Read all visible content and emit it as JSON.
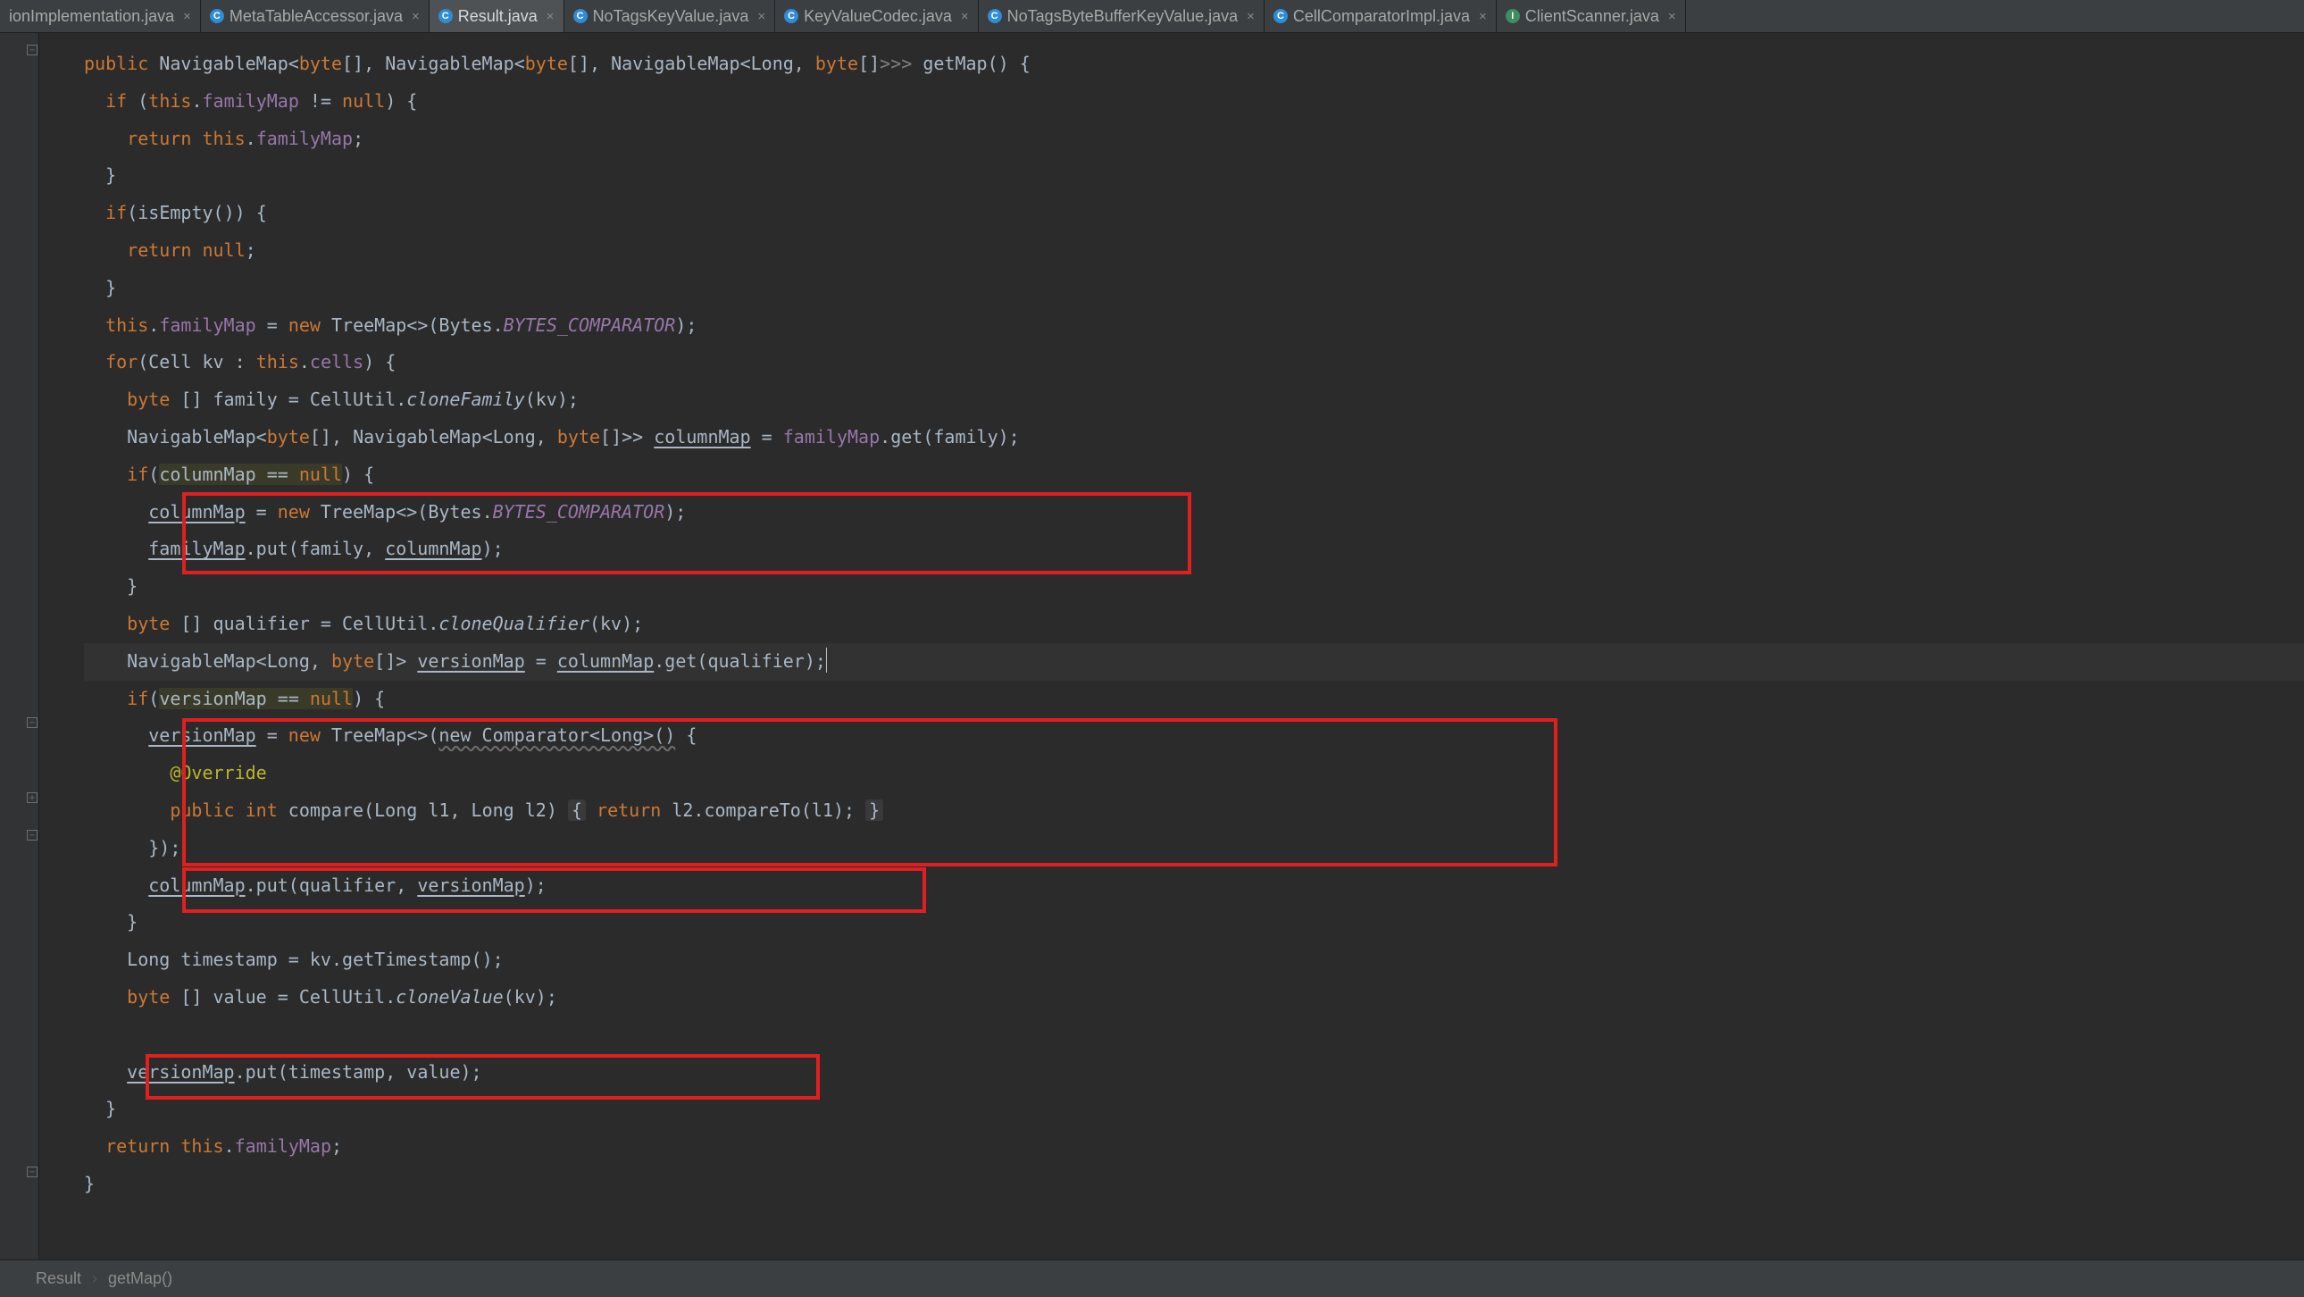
{
  "tabs": [
    {
      "label": "ionImplementation.java",
      "active": false
    },
    {
      "label": "MetaTableAccessor.java",
      "active": false
    },
    {
      "label": "Result.java",
      "active": true
    },
    {
      "label": "NoTagsKeyValue.java",
      "active": false
    },
    {
      "label": "KeyValueCodec.java",
      "active": false
    },
    {
      "label": "NoTagsByteBufferKeyValue.java",
      "active": false
    },
    {
      "label": "CellComparatorImpl.java",
      "active": false
    },
    {
      "label": "ClientScanner.java",
      "active": false
    }
  ],
  "breadcrumb": {
    "class": "Result",
    "method": "getMap()"
  },
  "code": {
    "l1": {
      "public": "public",
      "map": "NavigableMap",
      "byte": "byte",
      "long": "Long",
      "fn": "getMap"
    },
    "l2": {
      "if": "if",
      "this": "this",
      "field": "familyMap",
      "null": "null"
    },
    "l3": {
      "return": "return",
      "this": "this",
      "field": "familyMap"
    },
    "l5": {
      "if": "if",
      "fn": "isEmpty"
    },
    "l6": {
      "return": "return",
      "null": "null"
    },
    "l8": {
      "this": "this",
      "field": "familyMap",
      "new": "new",
      "tree": "TreeMap",
      "bytes": "Bytes",
      "comp": "BYTES_COMPARATOR"
    },
    "l9": {
      "for": "for",
      "cell": "Cell",
      "var": "kv",
      "this": "this",
      "field": "cells"
    },
    "l10": {
      "byte": "byte",
      "var": "family",
      "cu": "CellUtil",
      "fn": "cloneFamily",
      "arg": "kv"
    },
    "l11": {
      "map": "NavigableMap",
      "byte": "byte",
      "long": "Long",
      "var": "columnMap",
      "fm": "familyMap",
      "get": "get",
      "arg": "family"
    },
    "l12": {
      "if": "if",
      "var": "columnMap",
      "null": "null"
    },
    "l13": {
      "var": "columnMap",
      "new": "new",
      "tree": "TreeMap",
      "bytes": "Bytes",
      "comp": "BYTES_COMPARATOR"
    },
    "l14": {
      "fm": "familyMap",
      "put": "put",
      "a1": "family",
      "a2": "columnMap"
    },
    "l16": {
      "byte": "byte",
      "var": "qualifier",
      "cu": "CellUtil",
      "fn": "cloneQualifier",
      "arg": "kv"
    },
    "l17": {
      "map": "NavigableMap",
      "long": "Long",
      "byte": "byte",
      "var": "versionMap",
      "cm": "columnMap",
      "get": "get",
      "arg": "qualifier"
    },
    "l18": {
      "if": "if",
      "var": "versionMap",
      "null": "null"
    },
    "l19": {
      "var": "versionMap",
      "new": "new",
      "tree": "TreeMap",
      "comparator": "new Comparator<Long>()"
    },
    "l20": {
      "ann": "@Override"
    },
    "l21": {
      "public": "public",
      "int": "int",
      "fn": "compare",
      "long": "Long",
      "a1": "l1",
      "a2": "l2",
      "ret": "return",
      "body": "l2.compareTo(l1);"
    },
    "l23": {
      "cm": "columnMap",
      "put": "put",
      "a1": "qualifier",
      "a2": "versionMap"
    },
    "l25": {
      "long": "Long",
      "var": "timestamp",
      "kv": "kv",
      "fn": "getTimestamp"
    },
    "l26": {
      "byte": "byte",
      "var": "value",
      "cu": "CellUtil",
      "fn": "cloneValue",
      "arg": "kv"
    },
    "l28": {
      "vm": "versionMap",
      "put": "put",
      "a1": "timestamp",
      "a2": "value"
    },
    "l30": {
      "return": "return",
      "this": "this",
      "field": "familyMap"
    }
  }
}
